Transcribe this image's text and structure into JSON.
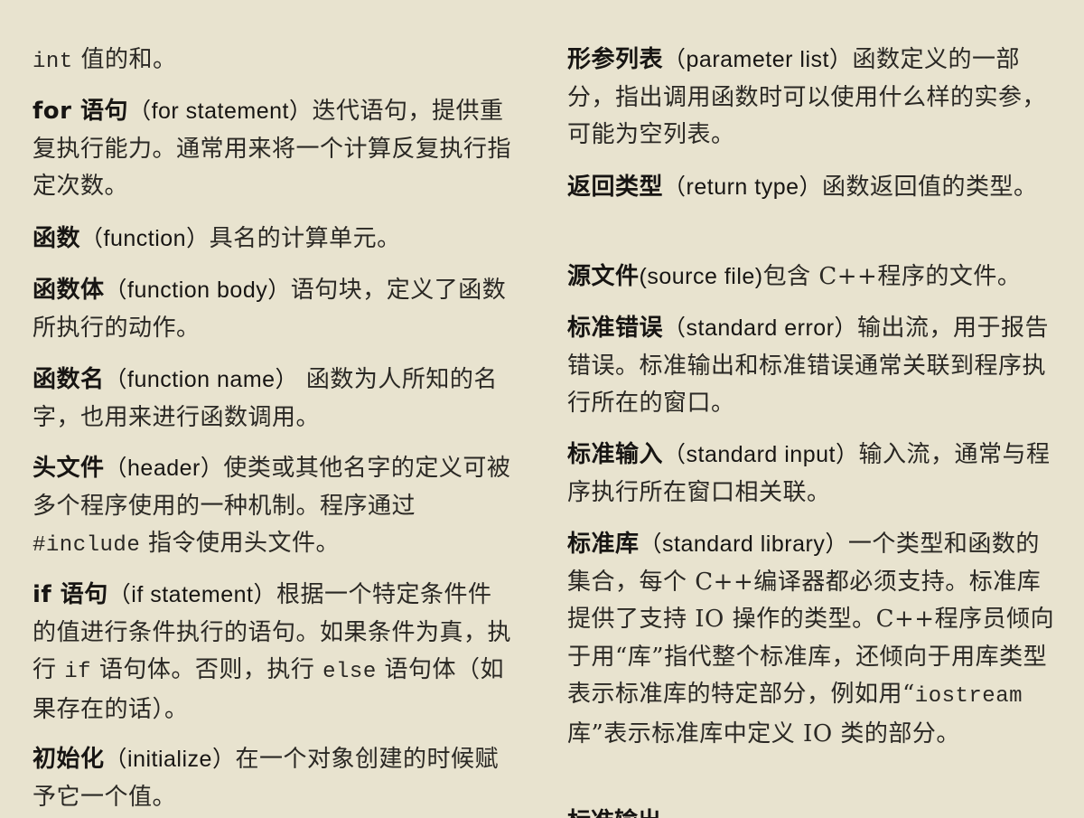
{
  "left": {
    "e0": {
      "code": "int",
      "def": " 值的和。"
    },
    "e1": {
      "term": "for 语句",
      "eng": "（for statement）",
      "def": "迭代语句，提供重复执行能力。通常用来将一个计算反复执行指定次数。"
    },
    "e2": {
      "term": "函数",
      "eng": "（function）",
      "def": "具名的计算单元。"
    },
    "e3": {
      "term": "函数体",
      "eng": "（function body）",
      "def": "语句块，定义了函数所执行的动作。"
    },
    "e4": {
      "term": "函数名",
      "eng": "（function name）",
      "def": " 函数为人所知的名字，也用来进行函数调用。"
    },
    "e5": {
      "term": "头文件",
      "eng": "（header）",
      "def1": "使类或其他名字的定义可被多个程序使用的一种机制。程序通过 ",
      "code": "#include",
      "def2": " 指令使用头文件。"
    },
    "e6": {
      "term": "if 语句",
      "eng": "（if statement）",
      "def1": "根据一个特定条件件的值进行条件执行的语句。如果条件为真，执行 ",
      "code1": "if",
      "def2": " 语句体。否则，执行 ",
      "code2": "else",
      "def3": " 语句体（如果存在的话）。"
    },
    "e7": {
      "term": "初始化",
      "eng": "（initialize）",
      "def": "在一个对象创建的时候赋予它一个值。"
    }
  },
  "right": {
    "e0": {
      "term": "形参列表",
      "eng": "（parameter list）",
      "def": "函数定义的一部分，指出调用函数时可以使用什么样的实参，可能为空列表。"
    },
    "e1": {
      "term": "返回类型",
      "eng": "（return type）",
      "def": "函数返回值的类型。"
    },
    "e2": {
      "term": "源文件",
      "eng": "(source file)",
      "def": "包含 C++程序的文件。"
    },
    "e3": {
      "term": "标准错误",
      "eng": "（standard error）",
      "def": "输出流，用于报告错误。标准输出和标准错误通常关联到程序执行所在的窗口。"
    },
    "e4": {
      "term": "标准输入",
      "eng": "（standard input）",
      "def": "输入流，通常与程序执行所在窗口相关联。"
    },
    "e5": {
      "term": "标准库",
      "eng": "（standard library）",
      "def1": "一个类型和函数的集合，每个 C++编译器都必须支持。标准库提供了支持 IO 操作的类型。C++程序员倾向于用“库”指代整个标准库，还倾向于用库类型表示标准库的特定部分，例如用“",
      "code": "iostream",
      "def2": " 库”表示标准库中定义 IO 类的部分。"
    },
    "e6_partial": {
      "term": "标准输出"
    }
  }
}
